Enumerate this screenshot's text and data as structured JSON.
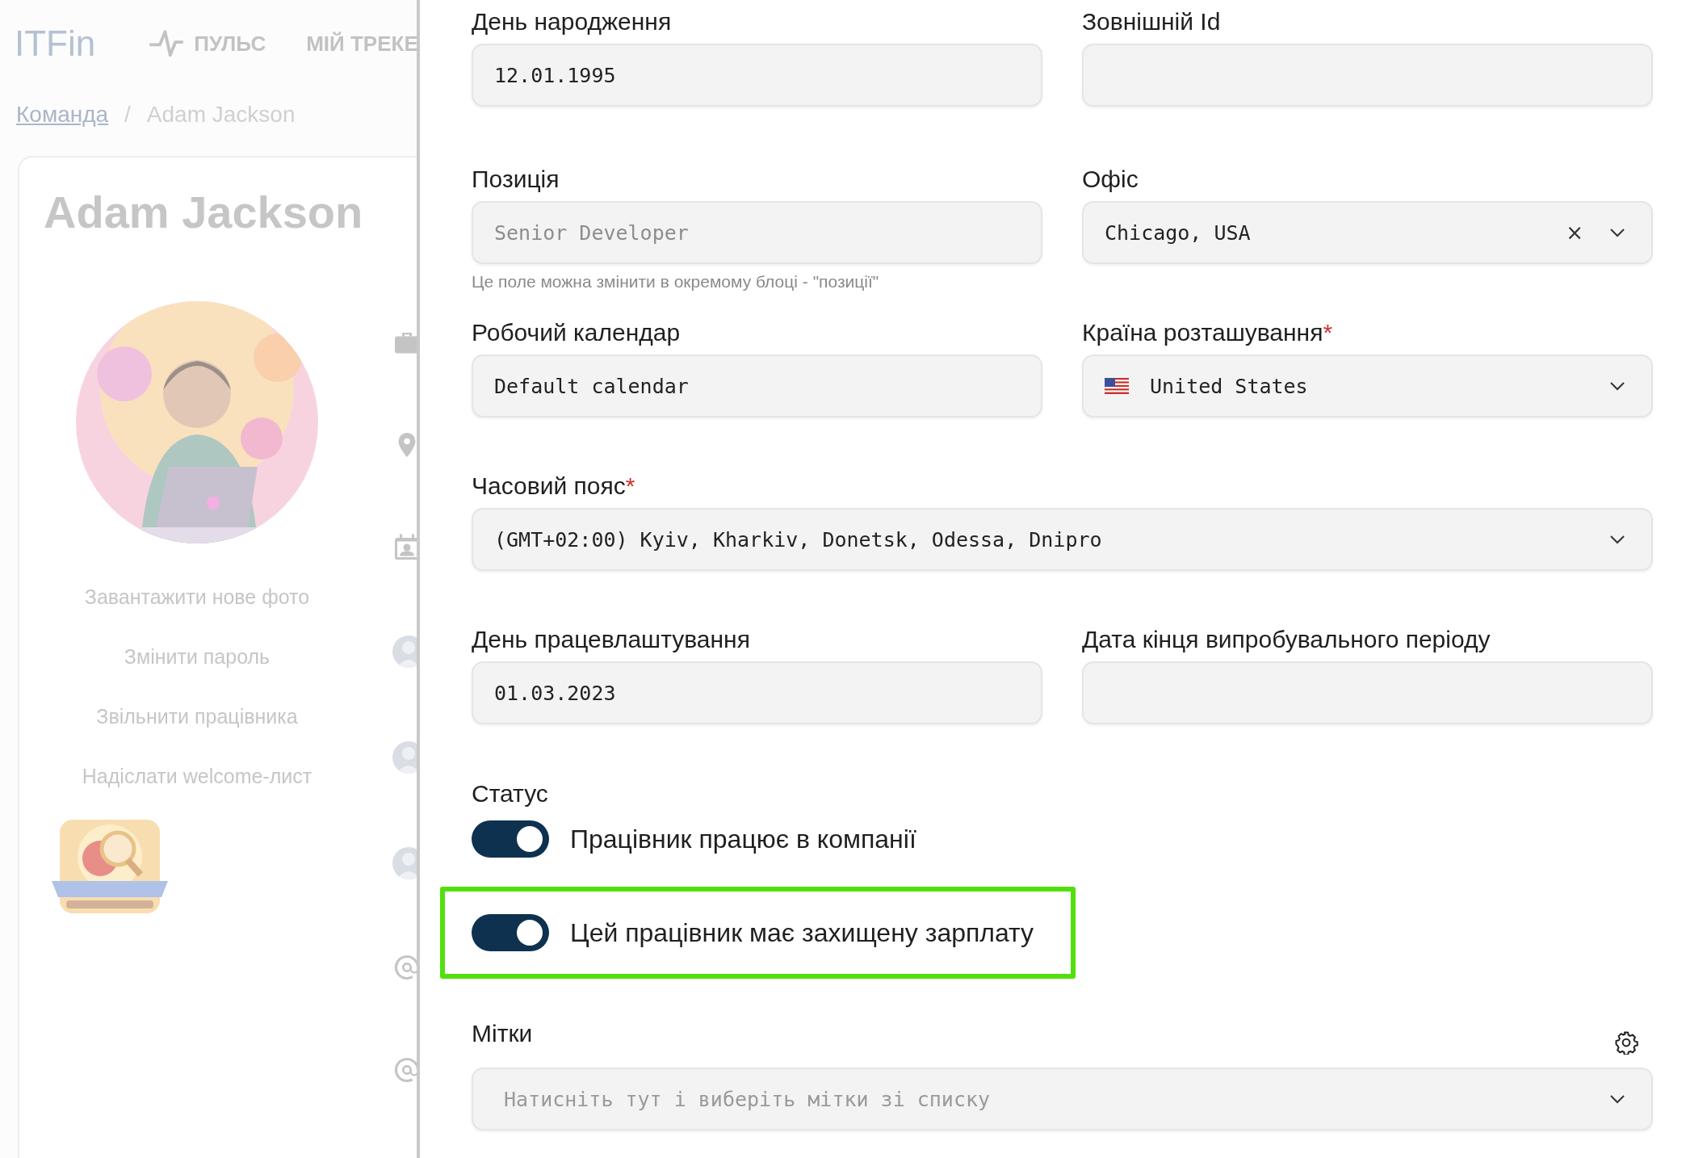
{
  "app": {
    "logo": "ITFin",
    "nav": [
      {
        "label": "ПУЛЬС",
        "kind": "pulse"
      },
      {
        "label": "МІЙ ТРЕКЕ",
        "kind": "plain"
      }
    ]
  },
  "breadcrumbs": {
    "separator": "/",
    "items": [
      {
        "label": "Команда",
        "link": true
      },
      {
        "label": "Adam Jackson",
        "link": false
      }
    ]
  },
  "profile": {
    "name": "Adam Jackson",
    "actions": [
      "Завантажити нове фото",
      "Змінити пароль",
      "Звільнити працівника",
      "Надіслати welcome-лист"
    ],
    "side_icons": [
      {
        "kind": "briefcase"
      },
      {
        "kind": "pin"
      },
      {
        "kind": "contact"
      },
      {
        "kind": "avatar"
      },
      {
        "kind": "avatar"
      },
      {
        "kind": "avatar"
      },
      {
        "kind": "at"
      },
      {
        "kind": "at"
      }
    ]
  },
  "form": {
    "rows": [
      [
        {
          "label": "День народження",
          "kind": "text",
          "value": "12.01.1995"
        },
        {
          "label": "Зовнішній Id",
          "kind": "text"
        }
      ],
      [
        {
          "label": "Позиція",
          "kind": "text",
          "value": "Senior Developer",
          "disabled": true,
          "hint": "Це поле можна змінити в окремому блоці - \"позиції\""
        },
        {
          "label": "Офіс",
          "kind": "select",
          "value": "Chicago, USA",
          "clear": "×"
        }
      ],
      [
        {
          "label": "Робочий календар",
          "kind": "text",
          "value": "Default calendar"
        },
        {
          "label": "Країна розташування",
          "required_mark": "*",
          "kind": "select",
          "flag": true,
          "value": "United States"
        }
      ],
      [
        {
          "label": "Часовий пояс",
          "required_mark": "*",
          "kind": "select",
          "value": "(GMT+02:00) Kyiv, Kharkiv, Donetsk, Odessa, Dnipro",
          "wide": true
        }
      ],
      [
        {
          "label": "День працевлаштування",
          "kind": "text",
          "value": "01.03.2023"
        },
        {
          "label": "Дата кінця випробувального періоду",
          "kind": "text"
        }
      ]
    ],
    "status": {
      "label": "Статус",
      "toggles": [
        {
          "label": "Працівник працює в компанії",
          "on": true,
          "highlighted": false
        },
        {
          "label": "Цей працівник має захищену зарплату",
          "on": true,
          "highlighted": true
        }
      ]
    },
    "tags": {
      "label": "Мітки",
      "placeholder": "Натисніть тут і виберіть мітки зі списку"
    }
  }
}
